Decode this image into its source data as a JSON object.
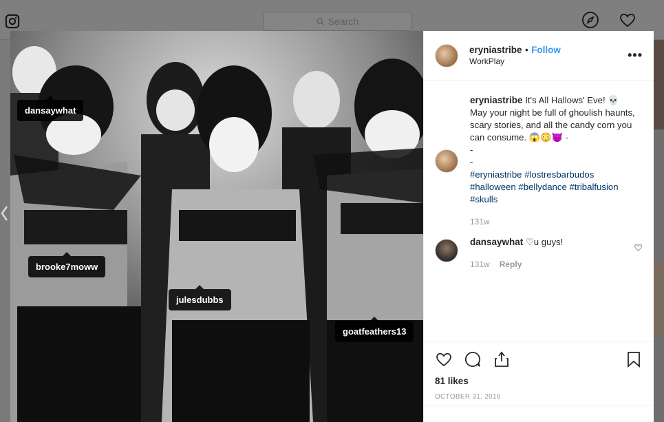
{
  "topbar": {
    "search_placeholder": "Search"
  },
  "post": {
    "author": "eryniastribe",
    "follow_label": "Follow",
    "separator": "•",
    "location": "WorkPlay",
    "more_label": "•••",
    "tags": [
      "dansaywhat",
      "brooke7moww",
      "julesdubbs",
      "goatfeathers13"
    ],
    "caption": {
      "username": "eryniastribe",
      "text": "It's All Hallows' Eve! 💀 May your night be full of ghoulish haunts, scary stories, and all the candy corn you can consume. 😱😳😈 -",
      "line_dash1": "-",
      "line_dash2": "-",
      "hashtags": [
        "#eryniastribe",
        "#lostresbarbudos",
        "#halloween",
        "#bellydance",
        "#tribalfusion",
        "#skulls"
      ],
      "time": "131w"
    },
    "comments": [
      {
        "username": "dansaywhat",
        "text": "♡u guys!",
        "time": "131w",
        "reply_label": "Reply"
      }
    ],
    "likes": "81 likes",
    "date": "OCTOBER 31, 2016"
  }
}
